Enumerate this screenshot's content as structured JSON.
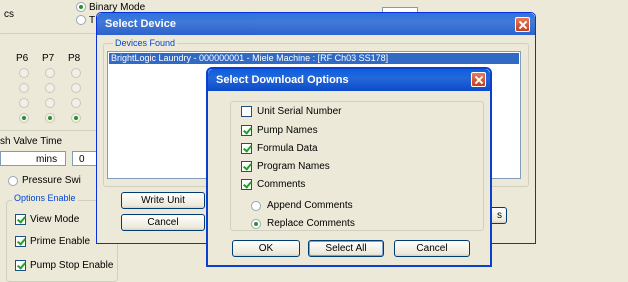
{
  "background": {
    "cs_fragment": "cs",
    "binary_mode": "Binary Mode",
    "t_fragment": "T",
    "pump_headers": [
      "P6",
      "P7",
      "P8"
    ],
    "valve_time": "sh Valve Time",
    "mins_label": "mins",
    "mins_value": "0",
    "pressure_switch": "Pressure Swi",
    "options_enable": "Options Enable",
    "view_mode": "View Mode",
    "prime_enable": "Prime Enable",
    "pump_stop_enable": "Pump Stop Enable"
  },
  "select_device": {
    "title": "Select Device",
    "devices_found_label": "Devices Found",
    "devices": [
      "BrightLogic Laundry - 000000001 - Miele Machine : [RF Ch03 SS178]"
    ],
    "write_unit_label": "Write Unit",
    "cancel_label": "Cancel",
    "s_fragment": "s"
  },
  "download_options": {
    "title": "Select Download Options",
    "checkboxes": [
      {
        "label": "Unit Serial Number",
        "checked": false
      },
      {
        "label": "Pump Names",
        "checked": true
      },
      {
        "label": "Formula Data",
        "checked": true
      },
      {
        "label": "Program Names",
        "checked": true
      },
      {
        "label": "Comments",
        "checked": true
      }
    ],
    "radios": [
      {
        "label": "Append Comments",
        "selected": false
      },
      {
        "label": "Replace Comments",
        "selected": true
      }
    ],
    "ok_label": "OK",
    "select_all_label": "Select All",
    "cancel_label": "Cancel"
  }
}
